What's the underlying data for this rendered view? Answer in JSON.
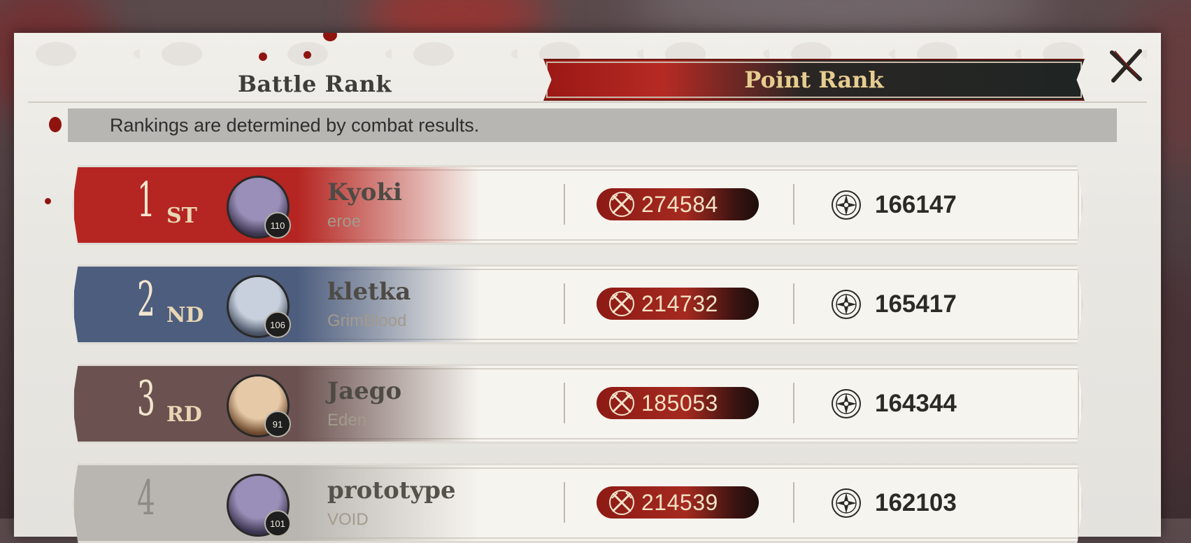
{
  "tabs": {
    "battle_rank": "Battle Rank",
    "point_rank": "Point Rank",
    "active": "point_rank"
  },
  "info_text": "Rankings are determined by combat results.",
  "icons": {
    "close": "close-x-icon",
    "combat": "crossed-swords-icon",
    "points": "compass-star-icon"
  },
  "colors": {
    "accent_red": "#9b1815",
    "gold_text": "#e6cd90",
    "rank1": "#b52521",
    "rank2": "#4d5d7e",
    "rank3": "#6b5250",
    "rank4": "#b9b6b1"
  },
  "rankings": [
    {
      "rank": "1",
      "suffix": "ST",
      "name": "Kyoki",
      "guild": "eroe",
      "level": "110",
      "combat": "274584",
      "points": "166147"
    },
    {
      "rank": "2",
      "suffix": "ND",
      "name": "kletka",
      "guild": "GrimBlood",
      "level": "106",
      "combat": "214732",
      "points": "165417"
    },
    {
      "rank": "3",
      "suffix": "RD",
      "name": "Jaego",
      "guild": "Eden",
      "level": "91",
      "combat": "185053",
      "points": "164344"
    },
    {
      "rank": "4",
      "suffix": "",
      "name": "prototype",
      "guild": "VOID",
      "level": "101",
      "combat": "214539",
      "points": "162103"
    }
  ]
}
